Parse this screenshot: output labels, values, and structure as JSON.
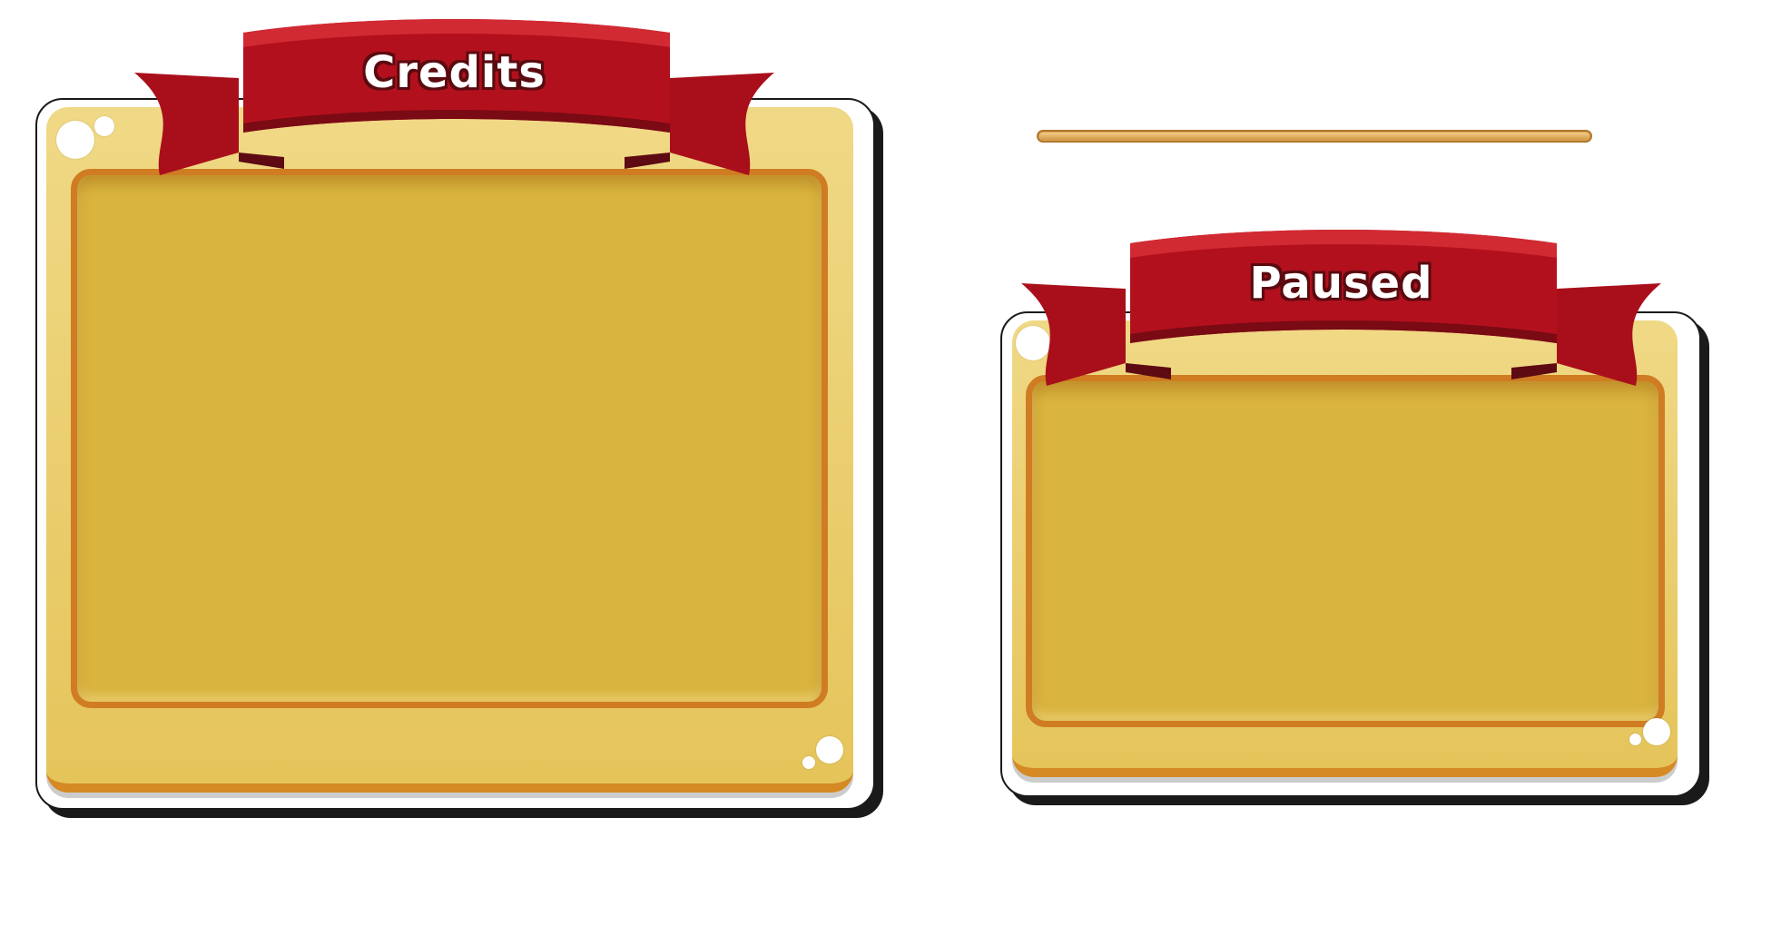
{
  "credits_panel": {
    "title": "Credits"
  },
  "paused_panel": {
    "title": "Paused"
  },
  "progress_bar": {
    "value_percent": 100
  },
  "colors": {
    "ribbon": "#b3101d",
    "board": "#e5c45a",
    "inner": "#d9b43e",
    "inner_border": "#cf7c22"
  }
}
